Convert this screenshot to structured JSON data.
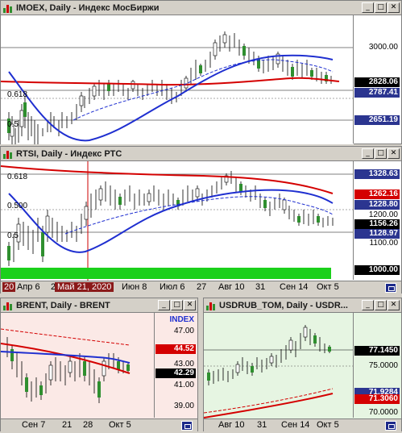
{
  "windows": {
    "imoex": {
      "title": "IMOEX, Daily - Индекс МосБиржи",
      "fib_labels": [
        "0.618",
        "0.5"
      ],
      "price_labels": [
        "3000.00"
      ],
      "price_tags": [
        {
          "label": "2828.06",
          "bg": "#000000",
          "fg": "#ffffff"
        },
        {
          "label": "2787.41",
          "bg": "#2b3590",
          "fg": "#ffffff"
        },
        {
          "label": "2651.19",
          "bg": "#2b3590",
          "fg": "#ffffff"
        }
      ]
    },
    "rtsi": {
      "title": "RTSI, Daily - Индекс РТС",
      "fib_labels": [
        "0.618",
        "0.500",
        "0.5"
      ],
      "price_labels": [
        "1200.00",
        "1100.00"
      ],
      "price_tags": [
        {
          "label": "1328.63",
          "bg": "#2b3590",
          "fg": "#ffffff"
        },
        {
          "label": "1262.16",
          "bg": "#d40000",
          "fg": "#ffffff"
        },
        {
          "label": "1228.80",
          "bg": "#2b3590",
          "fg": "#ffffff"
        },
        {
          "label": "1156.26",
          "bg": "#000000",
          "fg": "#ffffff"
        },
        {
          "label": "1128.97",
          "bg": "#2b3590",
          "fg": "#ffffff"
        },
        {
          "label": "1000.00",
          "bg": "#000000",
          "fg": "#ffffff"
        }
      ],
      "x_labels": [
        "20",
        "Апр 6",
        "2",
        "Май 21, 2020",
        "Июн 8",
        "Июл 6",
        "27",
        "Авг 10",
        "31",
        "Сен 14",
        "Окт 5"
      ]
    },
    "brent": {
      "title": "BRENT, Daily - BRENT",
      "price_labels": [
        "47.00",
        "43.00",
        "41.00",
        "39.00"
      ],
      "index_label": "INDEX",
      "price_tags": [
        {
          "label": "44.52",
          "bg": "#d40000",
          "fg": "#ffffff"
        },
        {
          "label": "42.29",
          "bg": "#000000",
          "fg": "#ffffff"
        }
      ],
      "x_labels": [
        "Сен 7",
        "21",
        "28",
        "Окт 5"
      ]
    },
    "usdrub": {
      "title": "USDRUB_TOM, Daily - USDR...",
      "price_labels": [
        "75.0000",
        "70.0000"
      ],
      "price_tags": [
        {
          "label": "77.1450",
          "bg": "#000000",
          "fg": "#ffffff"
        },
        {
          "label": "71.9284",
          "bg": "#2b3590",
          "fg": "#ffffff"
        },
        {
          "label": "71.3060",
          "bg": "#d40000",
          "fg": "#ffffff"
        }
      ],
      "x_labels": [
        "Авг 10",
        "31",
        "Сен 14",
        "Окт 5"
      ]
    }
  },
  "colors": {
    "ma_red": "#d40000",
    "ma_blue": "#1f2fd0",
    "candle_up": "#ffffff",
    "candle_down": "#2f8f2f",
    "brent_bg": "#fbe9e6",
    "usd_bg": "#e6f5e2",
    "volume_green": "#1bd01b"
  }
}
